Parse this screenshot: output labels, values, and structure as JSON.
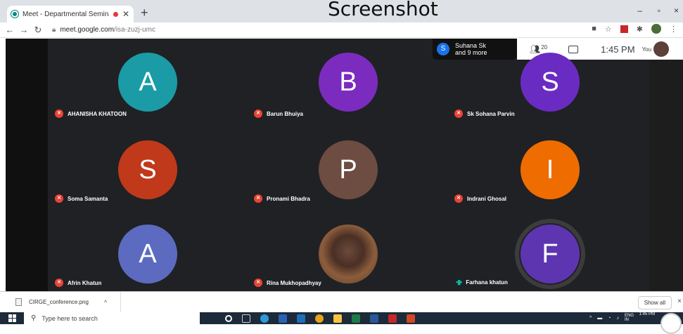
{
  "overlay_title": "Screenshot",
  "browser": {
    "tab_title": "Meet - Departmental Semina",
    "new_tab": "+",
    "url_host": "meet.google.com",
    "url_path": "/isa-zuzj-umc",
    "window_minimize": "–",
    "window_restore": "▫",
    "window_close": "×"
  },
  "meeting": {
    "info_pill": {
      "initial": "S",
      "line1": "Suhana Sk",
      "line2": "and 9 more"
    },
    "participant_count": "20",
    "time": "1:45 PM",
    "you_label": "You",
    "participants": [
      {
        "name": "AHANISHA KHATOON",
        "initial": "A",
        "color": "#1a9ba6",
        "muted": true
      },
      {
        "name": "Barun Bhuiya",
        "initial": "B",
        "color": "#7b2cbf",
        "muted": true
      },
      {
        "name": "Sk Sohana Parvin",
        "initial": "S",
        "color": "#6a2bc2",
        "muted": true
      },
      {
        "name": "Soma Samanta",
        "initial": "S",
        "color": "#c0391b",
        "muted": true
      },
      {
        "name": "Pronami Bhadra",
        "initial": "P",
        "color": "#6d4c41",
        "muted": true
      },
      {
        "name": "Indrani Ghosal",
        "initial": "I",
        "color": "#ef6c00",
        "muted": true
      },
      {
        "name": "Afrin Khatun",
        "initial": "A",
        "color": "#5c6bc0",
        "muted": true
      },
      {
        "name": "Rina Mukhopadhyay",
        "initial": "",
        "color": "#5a3a2a",
        "muted": true
      },
      {
        "name": "Farhana khatun",
        "initial": "F",
        "color": "#5e35b1",
        "muted": false
      }
    ]
  },
  "downloads": {
    "file_name": "CIRGE_conference.png",
    "show_all": "Show all",
    "close": "×"
  },
  "taskbar": {
    "search_placeholder": "Type here to search",
    "lang": "ENG",
    "lang2": "IN",
    "clock": "1:45 PM"
  }
}
